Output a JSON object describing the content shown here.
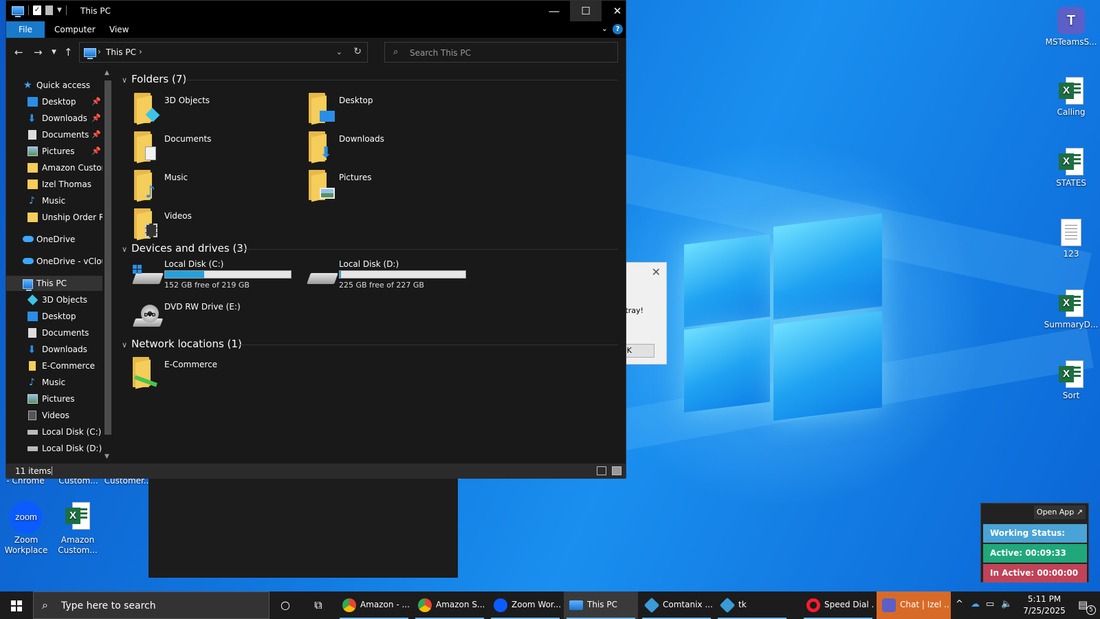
{
  "explorer": {
    "title": "This PC",
    "ribbon_tabs": [
      "File",
      "Computer",
      "View"
    ],
    "address_crumb": "This PC",
    "search_placeholder": "Search This PC",
    "status_items": "11 items"
  },
  "nav_pane": {
    "quick_access": "Quick access",
    "quick_items": [
      "Desktop",
      "Downloads",
      "Documents",
      "Pictures",
      "Amazon Custom",
      "Izel Thomas",
      "Music",
      "Unship Order Re"
    ],
    "onedrive": "OneDrive",
    "onedrive_vcloud": "OneDrive - vClouc",
    "this_pc": "This PC",
    "pc_items": [
      "3D Objects",
      "Desktop",
      "Documents",
      "Downloads",
      "E-Commerce",
      "Music",
      "Pictures",
      "Videos",
      "Local Disk (C:)",
      "Local Disk (D:)"
    ]
  },
  "content": {
    "folders_header": "Folders (7)",
    "folders": [
      "3D Objects",
      "Desktop",
      "Documents",
      "Downloads",
      "Music",
      "Pictures",
      "Videos"
    ],
    "devices_header": "Devices and drives (3)",
    "drives": [
      {
        "name": "Local Disk (C:)",
        "free": "152 GB free of 219 GB",
        "used_fraction": 0.31
      },
      {
        "name": "Local Disk (D:)",
        "free": "225 GB free of 227 GB",
        "used_fraction": 0.01
      },
      {
        "name": "DVD RW Drive (E:)"
      }
    ],
    "network_header": "Network locations (1)",
    "network": [
      "E-Commerce"
    ]
  },
  "dialog": {
    "message_fragment": "n tray!",
    "ok_label": "OK"
  },
  "desktop_icons": {
    "right": [
      "MSTeamsS...",
      "Calling",
      "STATES",
      "123",
      "SummaryD...",
      "Sort"
    ],
    "bottom": [
      "Zoom Workplace",
      "Amazon Custom..."
    ],
    "partial_labels": [
      "- Chrome",
      "Custom...",
      "Customer..."
    ]
  },
  "tracker": {
    "open_app": "Open App ↗",
    "working_status": "Working Status: Active",
    "active": "Active: 00:09:33",
    "inactive": "In Active: 00:00:00",
    "colors": {
      "status": "#4aa3d6",
      "active": "#20a87a",
      "inactive": "#c04358"
    }
  },
  "taskbar": {
    "search_text": "Type here to search",
    "apps": [
      "Amazon - ...",
      "Amazon S...",
      "Zoom Wor...",
      "This PC",
      "Comtanix ...",
      "tk",
      "Speed Dial ...",
      "Chat | Izel ..."
    ],
    "time": "5:11 PM",
    "date": "7/25/2025",
    "notification_count": "5"
  }
}
